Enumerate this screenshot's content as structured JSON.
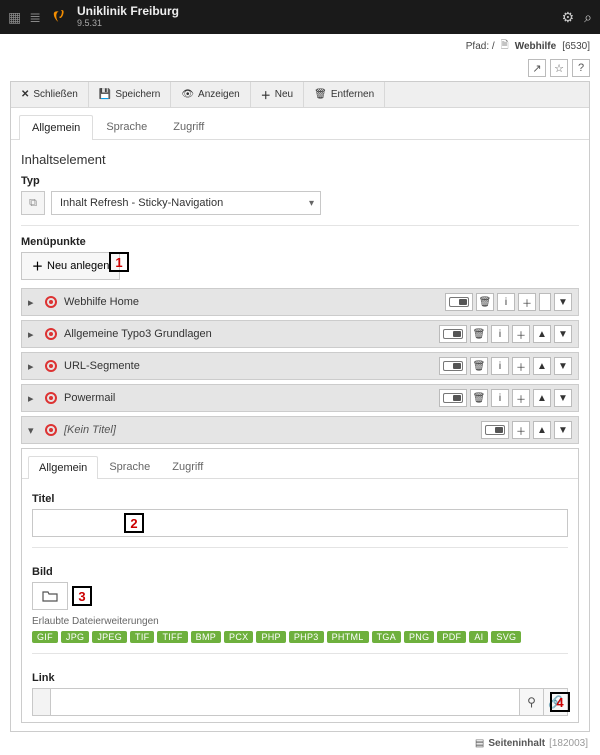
{
  "brand": {
    "title": "Uniklinik Freiburg",
    "version": "9.5.31"
  },
  "path": {
    "prefix": "Pfad: /",
    "page": "Webhilfe",
    "page_id": "[6530]"
  },
  "shortcuts": {
    "open": "↗",
    "star": "☆",
    "help": "?"
  },
  "toolbar": {
    "close": "Schließen",
    "save": "Speichern",
    "view": "Anzeigen",
    "new": "Neu",
    "delete": "Entfernen"
  },
  "tabs": {
    "general": "Allgemein",
    "language": "Sprache",
    "access": "Zugriff"
  },
  "content": {
    "heading": "Inhaltselement",
    "typ_label": "Typ",
    "typ_value": "Inhalt Refresh - Sticky-Navigation"
  },
  "menupunkte": {
    "label": "Menüpunkte",
    "neu": "Neu anlegen"
  },
  "items": [
    {
      "label": "Webhilfe Home"
    },
    {
      "label": "Allgemeine Typo3 Grundlagen"
    },
    {
      "label": "URL-Segmente"
    },
    {
      "label": "Powermail"
    },
    {
      "label": "[Kein Titel]"
    }
  ],
  "item_tabs": {
    "general": "Allgemein",
    "language": "Sprache",
    "access": "Zugriff"
  },
  "fields": {
    "titel": "Titel",
    "bild": "Bild",
    "allowed": "Erlaubte Dateierweiterungen",
    "exts": [
      "GIF",
      "JPG",
      "JPEG",
      "TIF",
      "TIFF",
      "BMP",
      "PCX",
      "PHP",
      "PHP3",
      "PHTML",
      "TGA",
      "PNG",
      "PDF",
      "AI",
      "SVG"
    ],
    "link": "Link"
  },
  "footer": {
    "label": "Seiteninhalt",
    "id": "[182003]"
  },
  "annotations": {
    "a1": "1",
    "a2": "2",
    "a3": "3",
    "a4": "4"
  }
}
